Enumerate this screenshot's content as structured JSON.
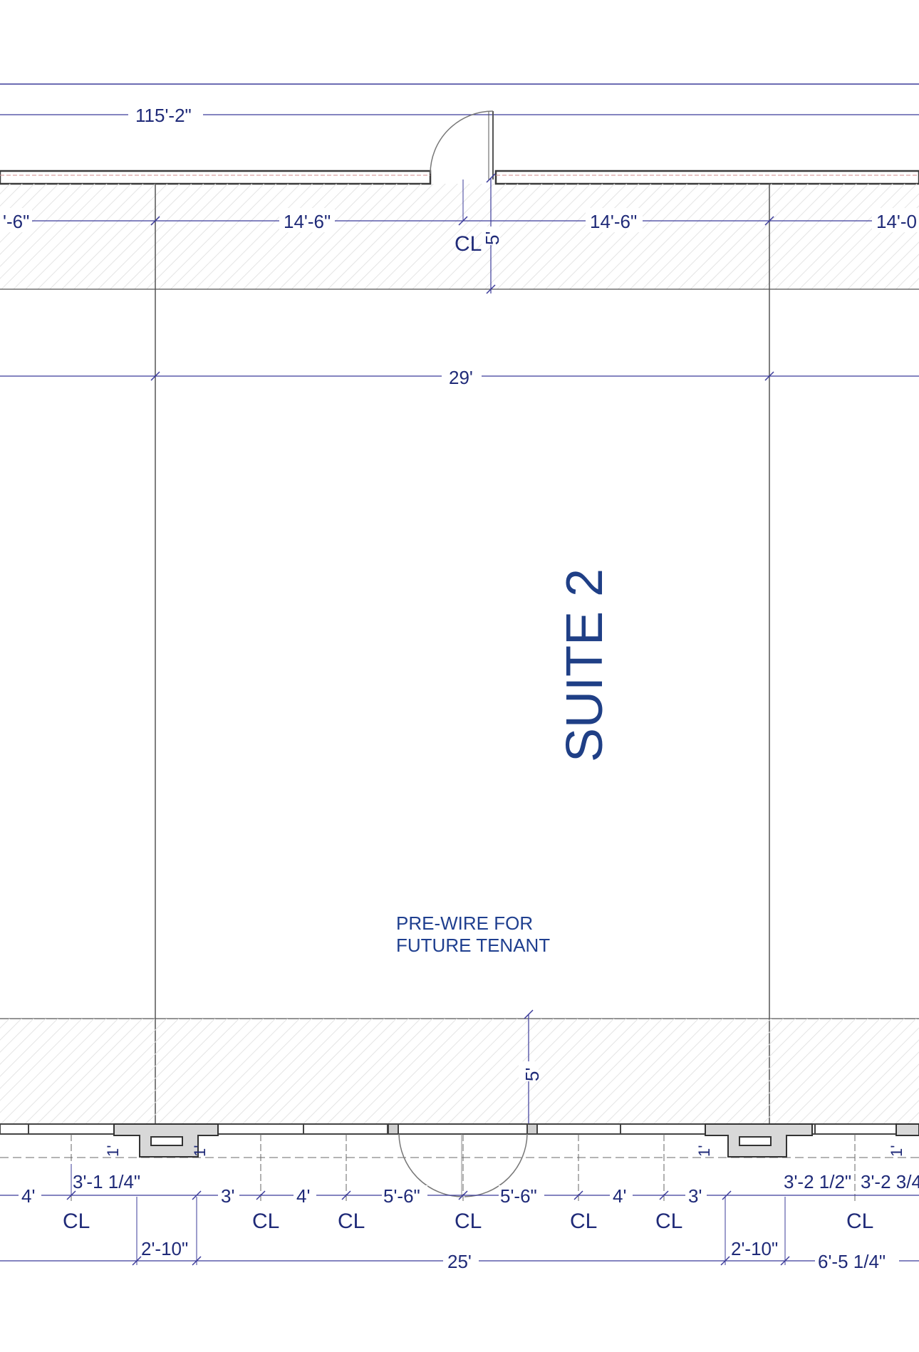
{
  "room": {
    "name": "SUITE 2",
    "note_line1": "PRE-WIRE FOR",
    "note_line2": "FUTURE TENANT"
  },
  "dimensions": {
    "overall": "115'-2\"",
    "top_left_partial": "'-6\"",
    "top_left": "14'-6\"",
    "top_right": "14'-6\"",
    "top_right_partial": "14'-0",
    "top_depth": "5'",
    "suite_width": "29'",
    "bottom_depth": "5'",
    "front_left_partial": "4'",
    "front_pier_left": "3'-1 1/4\"",
    "front_a": "3'",
    "front_b": "4'",
    "front_c": "5'-6\"",
    "front_d": "5'-6\"",
    "front_e": "4'",
    "front_f": "3'",
    "front_pier_right_a": "3'-2 1/2\"",
    "front_pier_right_b": "3'-2 3/4",
    "pier_left_width": "2'-10\"",
    "front_total": "25'",
    "pier_right_width": "2'-10\"",
    "right_partial": "6'-5 1/4\"",
    "pier_depth": "1'"
  },
  "centerline_symbol": "CL",
  "colors": {
    "dimension": "#1f2a78",
    "suite_label": "#1f3f86",
    "wall": "#3a3a3a",
    "hatch": "#e2e2e2"
  }
}
